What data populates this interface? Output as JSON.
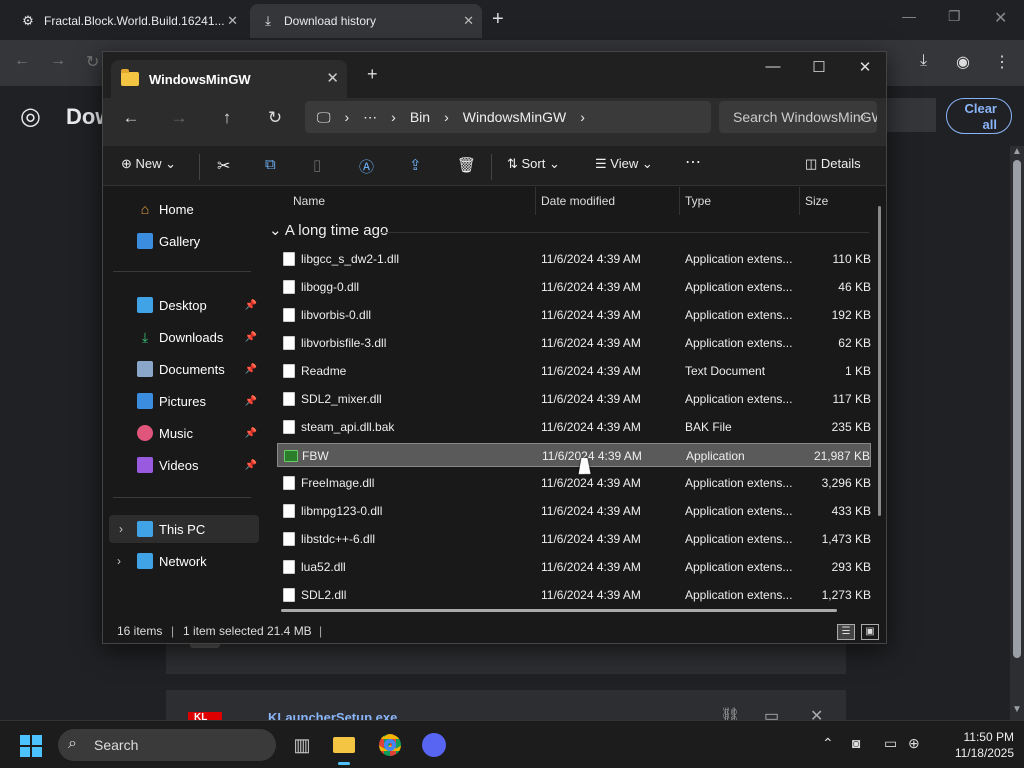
{
  "chrome": {
    "tabs": [
      {
        "label": "Fractal.Block.World.Build.16241..."
      },
      {
        "label": "Download history"
      }
    ],
    "page_title": "Dow",
    "clear_all": "Clear all",
    "download_item": {
      "name": "KLauncherSetup.exe",
      "icon_text": "KL"
    }
  },
  "explorer": {
    "tab_title": "WindowsMinGW",
    "breadcrumb": [
      "Bin",
      "WindowsMinGW"
    ],
    "search_placeholder": "Search WindowsMinGW",
    "toolbar": {
      "new": "New",
      "sort": "Sort",
      "view": "View",
      "details": "Details"
    },
    "sidebar": {
      "top": [
        "Home",
        "Gallery"
      ],
      "pinned": [
        "Desktop",
        "Downloads",
        "Documents",
        "Pictures",
        "Music",
        "Videos"
      ],
      "bottom": [
        "This PC",
        "Network"
      ]
    },
    "columns": {
      "name": "Name",
      "date": "Date modified",
      "type": "Type",
      "size": "Size"
    },
    "group": "A long time ago",
    "files": [
      {
        "name": "libgcc_s_dw2-1.dll",
        "date": "11/6/2024 4:39 AM",
        "type": "Application extens...",
        "size": "110 KB",
        "kind": "doc"
      },
      {
        "name": "libogg-0.dll",
        "date": "11/6/2024 4:39 AM",
        "type": "Application extens...",
        "size": "46 KB",
        "kind": "doc"
      },
      {
        "name": "libvorbis-0.dll",
        "date": "11/6/2024 4:39 AM",
        "type": "Application extens...",
        "size": "192 KB",
        "kind": "doc"
      },
      {
        "name": "libvorbisfile-3.dll",
        "date": "11/6/2024 4:39 AM",
        "type": "Application extens...",
        "size": "62 KB",
        "kind": "doc"
      },
      {
        "name": "Readme",
        "date": "11/6/2024 4:39 AM",
        "type": "Text Document",
        "size": "1 KB",
        "kind": "doc"
      },
      {
        "name": "SDL2_mixer.dll",
        "date": "11/6/2024 4:39 AM",
        "type": "Application extens...",
        "size": "117 KB",
        "kind": "doc"
      },
      {
        "name": "steam_api.dll.bak",
        "date": "11/6/2024 4:39 AM",
        "type": "BAK File",
        "size": "235 KB",
        "kind": "doc"
      },
      {
        "name": "FBW",
        "date": "11/6/2024 4:39 AM",
        "type": "Application",
        "size": "21,987 KB",
        "kind": "app",
        "selected": true
      },
      {
        "name": "FreeImage.dll",
        "date": "11/6/2024 4:39 AM",
        "type": "Application extens...",
        "size": "3,296 KB",
        "kind": "doc"
      },
      {
        "name": "libmpg123-0.dll",
        "date": "11/6/2024 4:39 AM",
        "type": "Application extens...",
        "size": "433 KB",
        "kind": "doc"
      },
      {
        "name": "libstdc++-6.dll",
        "date": "11/6/2024 4:39 AM",
        "type": "Application extens...",
        "size": "1,473 KB",
        "kind": "doc"
      },
      {
        "name": "lua52.dll",
        "date": "11/6/2024 4:39 AM",
        "type": "Application extens...",
        "size": "293 KB",
        "kind": "doc"
      },
      {
        "name": "SDL2.dll",
        "date": "11/6/2024 4:39 AM",
        "type": "Application extens...",
        "size": "1,273 KB",
        "kind": "doc"
      }
    ],
    "status": {
      "count": "16 items",
      "selected": "1 item selected",
      "size": "21.4 MB"
    }
  },
  "taskbar": {
    "search": "Search",
    "time": "11:50 PM",
    "date": "11/18/2025"
  },
  "colors": {
    "accent": "#4cc2ff",
    "link": "#8ab4f8",
    "folder": "#f4c542"
  }
}
